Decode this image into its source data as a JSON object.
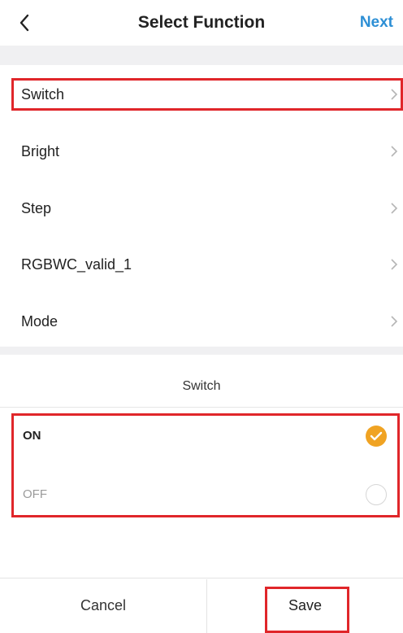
{
  "header": {
    "title": "Select Function",
    "next_label": "Next"
  },
  "functions": [
    {
      "label": "Switch",
      "selected": true
    },
    {
      "label": "Bright"
    },
    {
      "label": "Step"
    },
    {
      "label": "RGBWC_valid_1"
    },
    {
      "label": "Mode"
    }
  ],
  "panel": {
    "title": "Switch",
    "options": [
      {
        "label": "ON",
        "checked": true
      },
      {
        "label": "OFF",
        "checked": false
      }
    ]
  },
  "footer": {
    "cancel_label": "Cancel",
    "save_label": "Save"
  },
  "colors": {
    "accent_blue": "#2d8fd5",
    "check_orange": "#f0a323",
    "highlight_red": "#e0262a"
  },
  "icons": {
    "back": "chevron-left-icon",
    "row": "chevron-right-icon",
    "check": "check-icon"
  }
}
